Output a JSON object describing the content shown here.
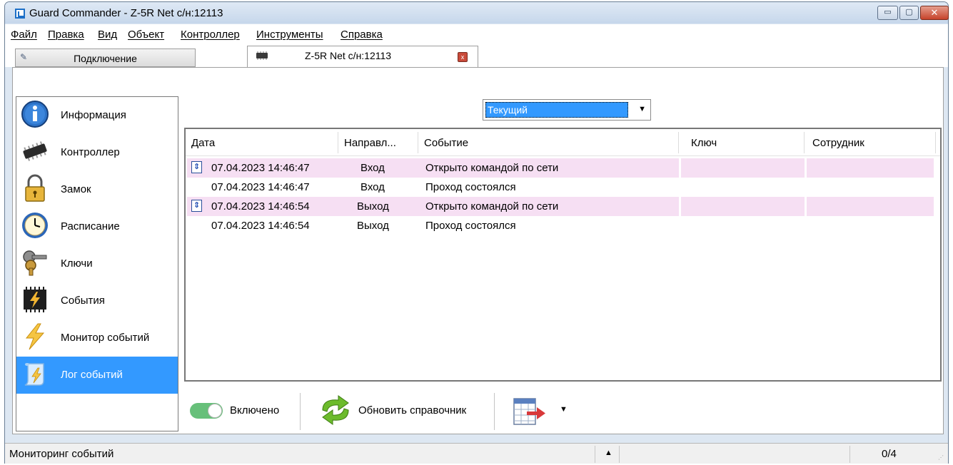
{
  "window": {
    "title": "Guard Commander - Z-5R Net с/н:12113",
    "minimize": "▭",
    "maximize": "▢",
    "close": "✕"
  },
  "menu": [
    "Файл",
    "Правка",
    "Вид",
    "Объект",
    "Контроллер",
    "Инструменты",
    "Справка"
  ],
  "tabs": {
    "connection": "Подключение",
    "device": "Z-5R Net с/н:12113",
    "close": "x"
  },
  "sidebar": {
    "items": [
      {
        "label": "Информация",
        "icon": "info-icon"
      },
      {
        "label": "Контроллер",
        "icon": "chip-icon"
      },
      {
        "label": "Замок",
        "icon": "lock-icon"
      },
      {
        "label": "Расписание",
        "icon": "clock-icon"
      },
      {
        "label": "Ключи",
        "icon": "keys-icon"
      },
      {
        "label": "События",
        "icon": "events-chip-icon"
      },
      {
        "label": "Монитор событий",
        "icon": "lightning-icon"
      },
      {
        "label": "Лог событий",
        "icon": "log-scroll-icon"
      }
    ],
    "active_index": 7
  },
  "filter": {
    "selected": "Текущий"
  },
  "table": {
    "columns": [
      "Дата",
      "Направл...",
      "Событие",
      "Ключ",
      "Сотрудник"
    ],
    "rows": [
      {
        "date": "07.04.2023 14:46:47",
        "direction": "Вход",
        "event": "Открыто командой по сети",
        "key": "",
        "employee": "",
        "highlight": true,
        "icon": "arrow-up-down-icon"
      },
      {
        "date": "07.04.2023 14:46:47",
        "direction": "Вход",
        "event": "Проход состоялся",
        "key": "",
        "employee": "",
        "highlight": false,
        "icon": ""
      },
      {
        "date": "07.04.2023 14:46:54",
        "direction": "Выход",
        "event": "Открыто командой по сети",
        "key": "",
        "employee": "",
        "highlight": true,
        "icon": "arrow-up-down-icon"
      },
      {
        "date": "07.04.2023 14:46:54",
        "direction": "Выход",
        "event": "Проход состоялся",
        "key": "",
        "employee": "",
        "highlight": false,
        "icon": ""
      }
    ]
  },
  "toolbar": {
    "toggle_label": "Включено",
    "toggle_on": true,
    "refresh_label": "Обновить справочник"
  },
  "status": {
    "text": "Мониторинг событий",
    "count": "0/4"
  },
  "colors": {
    "accent": "#3399ff",
    "row_highlight": "#f6dff3",
    "toggle_on": "#67c07a",
    "title_bar": "#c6d7eb"
  }
}
